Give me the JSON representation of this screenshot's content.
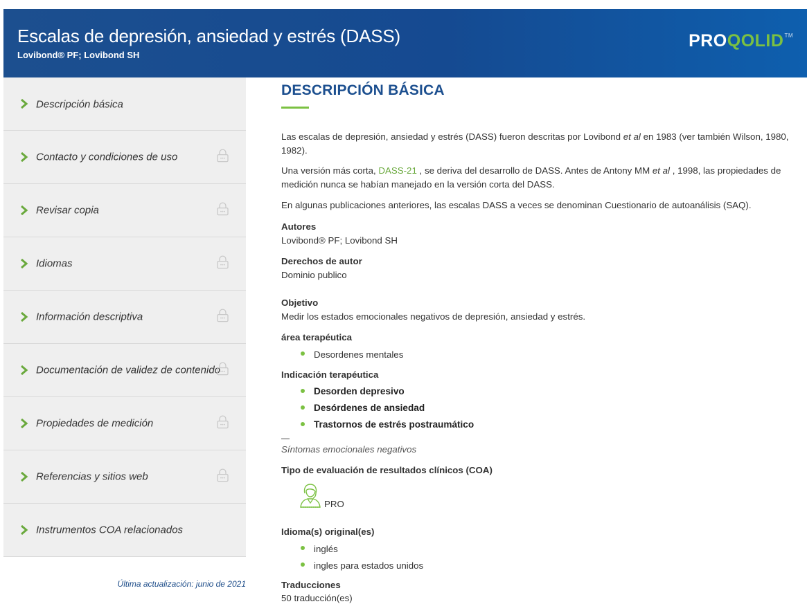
{
  "header": {
    "title": "Escalas de depresión, ansiedad y estrés (DASS)",
    "subtitle": "Lovibond® PF; Lovibond SH",
    "logo_pro": "PRO",
    "logo_qolid": "QOLID",
    "logo_tm": "TM"
  },
  "sidebar": {
    "items": [
      {
        "label": "Descripción básica",
        "locked": false
      },
      {
        "label": "Contacto y condiciones de uso",
        "locked": true
      },
      {
        "label": "Revisar copia",
        "locked": true
      },
      {
        "label": "Idiomas",
        "locked": true
      },
      {
        "label": "Información descriptiva",
        "locked": true
      },
      {
        "label": "Documentación de validez de contenido",
        "locked": true
      },
      {
        "label": "Propiedades de medición",
        "locked": true
      },
      {
        "label": "Referencias y sitios web",
        "locked": true
      },
      {
        "label": "Instrumentos COA relacionados",
        "locked": false
      }
    ],
    "last_updated": "Última actualización: junio de 2021"
  },
  "main": {
    "heading": "DESCRIPCIÓN BÁSICA",
    "para1_a": "Las escalas de depresión, ansiedad y estrés (DASS) fueron descritas por Lovibond ",
    "para1_etal": "et al",
    "para1_b": " en 1983 (ver también Wilson, 1980, 1982).",
    "para2_a": "Una versión más corta, ",
    "para2_link": "DASS-21",
    "para2_b": " , se deriva del desarrollo de DASS. Antes de Antony MM ",
    "para2_etal": "et al",
    "para2_c": " , 1998, las propiedades de medición nunca se habían manejado en la versión corta del DASS.",
    "para3": "En algunas publicaciones anteriores, las escalas DASS a veces se denominan Cuestionario de autoanálisis (SAQ).",
    "authors_label": "Autores",
    "authors_value": "Lovibond® PF; Lovibond SH",
    "copyright_label": "Derechos de autor",
    "copyright_value": "Dominio publico",
    "objective_label": "Objetivo",
    "objective_value": "Medir los estados emocionales negativos de depresión, ansiedad y estrés.",
    "therapeutic_area_label": "área terapéutica",
    "therapeutic_areas": [
      "Desordenes mentales"
    ],
    "indication_label": "Indicación terapéutica",
    "indications": [
      "Desorden depresivo",
      "Desórdenes de ansiedad",
      "Trastornos de estrés postraumático"
    ],
    "dash": "—",
    "indication_note": "Síntomas emocionales negativos",
    "coa_label": "Tipo de evaluación de resultados clínicos (COA)",
    "coa_value": "PRO",
    "languages_label": "Idioma(s) original(es)",
    "languages": [
      "inglés",
      "ingles para estados unidos"
    ],
    "translations_label": "Traducciones",
    "translations_value": "50 traducción(es)"
  },
  "colors": {
    "header_blue": "#1c4f8f",
    "accent_green": "#7bc142",
    "link_green": "#6aa93d",
    "sidebar_bg": "#efefef"
  },
  "icons": {
    "sidebar_chevron": "chevron-right-icon",
    "sidebar_lock": "lock-icon",
    "coa_type": "patient-person-icon"
  }
}
